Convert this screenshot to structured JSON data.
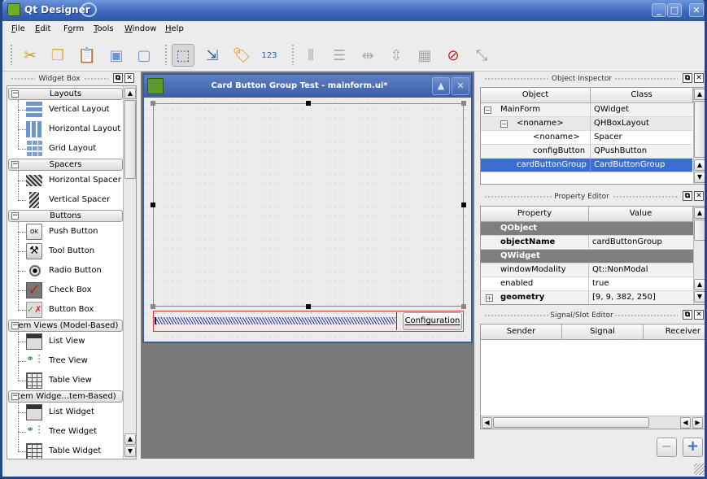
{
  "window": {
    "title": "Qt Designer",
    "controls": {
      "minimize": "_",
      "maximize": "□",
      "close": "✕"
    }
  },
  "menu": {
    "items": [
      {
        "label": "File",
        "mnemonic": "F"
      },
      {
        "label": "Edit",
        "mnemonic": "E"
      },
      {
        "label": "Form",
        "mnemonic": "o"
      },
      {
        "label": "Tools",
        "mnemonic": "T"
      },
      {
        "label": "Window",
        "mnemonic": "W"
      },
      {
        "label": "Help",
        "mnemonic": "H"
      }
    ]
  },
  "toolbar": {
    "buttons": [
      {
        "name": "cut-icon",
        "glyph": "✂"
      },
      {
        "name": "copy-icon",
        "glyph": "❐"
      },
      {
        "name": "paste-icon",
        "glyph": "📋"
      },
      {
        "name": "send-to-back-icon",
        "glyph": "▣"
      },
      {
        "name": "bring-to-front-icon",
        "glyph": "▢"
      },
      {
        "name": "edit-widgets-icon",
        "glyph": "⬚",
        "active": true
      },
      {
        "name": "edit-signals-slots-icon",
        "glyph": "⇲"
      },
      {
        "name": "edit-buddies-icon",
        "glyph": "🏷"
      },
      {
        "name": "edit-tab-order-icon",
        "glyph": "123"
      },
      {
        "name": "layout-horizontal-icon",
        "glyph": "⫴"
      },
      {
        "name": "layout-vertical-icon",
        "glyph": "☰"
      },
      {
        "name": "layout-horizontal-splitter-icon",
        "glyph": "⇹"
      },
      {
        "name": "layout-vertical-splitter-icon",
        "glyph": "⇳"
      },
      {
        "name": "layout-grid-icon",
        "glyph": "▦"
      },
      {
        "name": "break-layout-icon",
        "glyph": "⊘"
      },
      {
        "name": "adjust-size-icon",
        "glyph": "⤡"
      }
    ]
  },
  "widget_box": {
    "title": "Widget Box",
    "categories": [
      {
        "label": "Layouts",
        "items": [
          "Vertical Layout",
          "Horizontal Layout",
          "Grid Layout"
        ]
      },
      {
        "label": "Spacers",
        "items": [
          "Horizontal Spacer",
          "Vertical Spacer"
        ]
      },
      {
        "label": "Buttons",
        "items": [
          "Push Button",
          "Tool Button",
          "Radio Button",
          "Check Box",
          "Button Box"
        ]
      },
      {
        "label": "Item Views (Model-Based)",
        "items": [
          "List View",
          "Tree View",
          "Table View"
        ]
      },
      {
        "label": "Item Widge...tem-Based)",
        "items": [
          "List Widget",
          "Tree Widget",
          "Table Widget"
        ]
      }
    ],
    "push_button_icon_text": "OK"
  },
  "form_window": {
    "title": "Card Button Group Test - mainform.ui*",
    "config_button": "Configuration",
    "config_mnemonic": "C"
  },
  "object_inspector": {
    "title": "Object Inspector",
    "columns": [
      "Object",
      "Class"
    ],
    "rows": [
      {
        "object": "MainForm",
        "class": "QWidget",
        "depth": 0,
        "expander": "−"
      },
      {
        "object": "<noname>",
        "class": "QHBoxLayout",
        "depth": 1,
        "expander": "−"
      },
      {
        "object": "<noname>",
        "class": "Spacer",
        "depth": 2
      },
      {
        "object": "configButton",
        "class": "QPushButton",
        "depth": 2
      },
      {
        "object": "cardButtonGroup",
        "class": "CardButtonGroup",
        "depth": 2,
        "selected": true
      }
    ]
  },
  "property_editor": {
    "title": "Property Editor",
    "columns": [
      "Property",
      "Value"
    ],
    "rows": [
      {
        "type": "group",
        "property": "QObject"
      },
      {
        "property": "objectName",
        "value": "cardButtonGroup",
        "bold": true
      },
      {
        "type": "group",
        "property": "QWidget"
      },
      {
        "property": "windowModality",
        "value": "Qt::NonModal"
      },
      {
        "property": "enabled",
        "value": "true"
      },
      {
        "property": "geometry",
        "value": "[9, 9, 382, 250]",
        "bold": true,
        "expander": "+"
      }
    ]
  },
  "signal_slot_editor": {
    "title": "Signal/Slot Editor",
    "columns": [
      "Sender",
      "Signal",
      "Receiver"
    ],
    "remove_label": "−",
    "add_label": "+"
  }
}
